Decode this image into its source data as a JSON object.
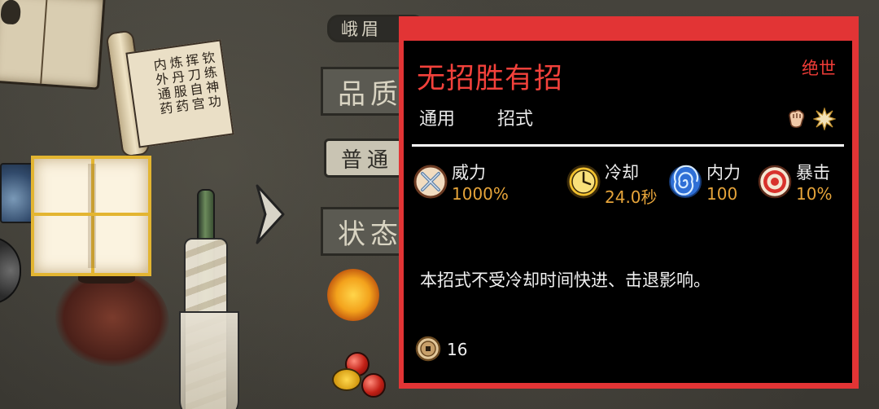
{
  "background": {
    "sect_label": "峨眉",
    "quality_label": "品质",
    "quality_value": "普通",
    "status_label": "状态",
    "scroll_text": "钦练神功 挥刀自宫 炼丹服药 内外通药"
  },
  "tooltip": {
    "skill_name": "无招胜有招",
    "rank": "绝世",
    "categories": [
      "通用",
      "招式"
    ],
    "icons": [
      "fist-icon",
      "burst-icon"
    ],
    "stats": [
      {
        "label": "威力",
        "value": "1000%",
        "icon": "crossed-swords-icon"
      },
      {
        "label": "冷却",
        "value": "24.0秒",
        "icon": "clock-icon"
      },
      {
        "label": "内力",
        "value": "100",
        "icon": "swirl-icon"
      },
      {
        "label": "暴击",
        "value": "10%",
        "icon": "target-icon"
      }
    ],
    "description": "本招式不受冷却时间快进、击退影响。",
    "cost": {
      "icon": "copper-coin-icon",
      "value": "16"
    }
  },
  "colors": {
    "panel_border": "#e23435",
    "title_red": "#f2413b",
    "stat_value_gold": "#e6a43a",
    "slot_highlight": "#e3b531"
  }
}
